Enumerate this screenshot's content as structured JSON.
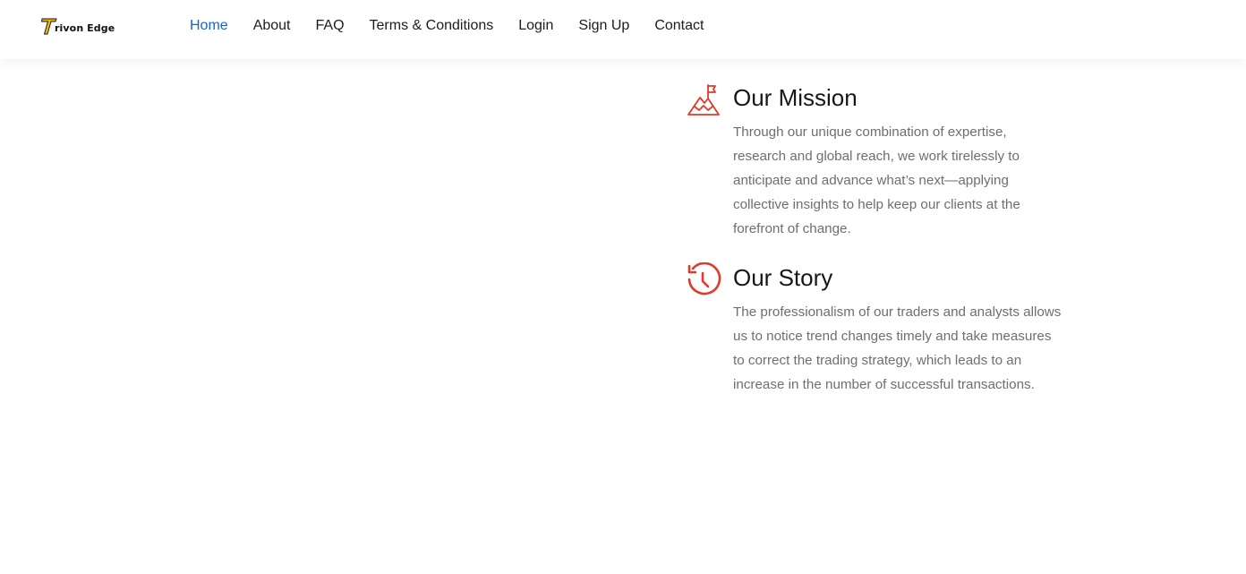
{
  "brand": {
    "name": "rivon Edge",
    "accent_color": "#f2b705"
  },
  "nav": {
    "items": [
      {
        "label": "Home",
        "active": true
      },
      {
        "label": "About",
        "active": false
      },
      {
        "label": "FAQ",
        "active": false
      },
      {
        "label": "Terms & Conditions",
        "active": false
      },
      {
        "label": "Login",
        "active": false
      },
      {
        "label": "Sign Up",
        "active": false
      },
      {
        "label": "Contact",
        "active": false
      }
    ],
    "active_color": "#1266d4"
  },
  "features": [
    {
      "icon": "mountain-flag-icon",
      "title": "Our Mission",
      "text": "Through our unique combination of expertise, research and global reach, we work tirelessly to anticipate and advance what’s next—applying collective insights to help keep our clients at the forefront of change."
    },
    {
      "icon": "history-clock-icon",
      "title": "Our Story",
      "text": "The professionalism of our traders and analysts allows us to notice trend changes timely and take measures to correct the trading strategy, which leads to an increase in the number of successful transactions."
    }
  ],
  "icon_color": "#e03a2a"
}
